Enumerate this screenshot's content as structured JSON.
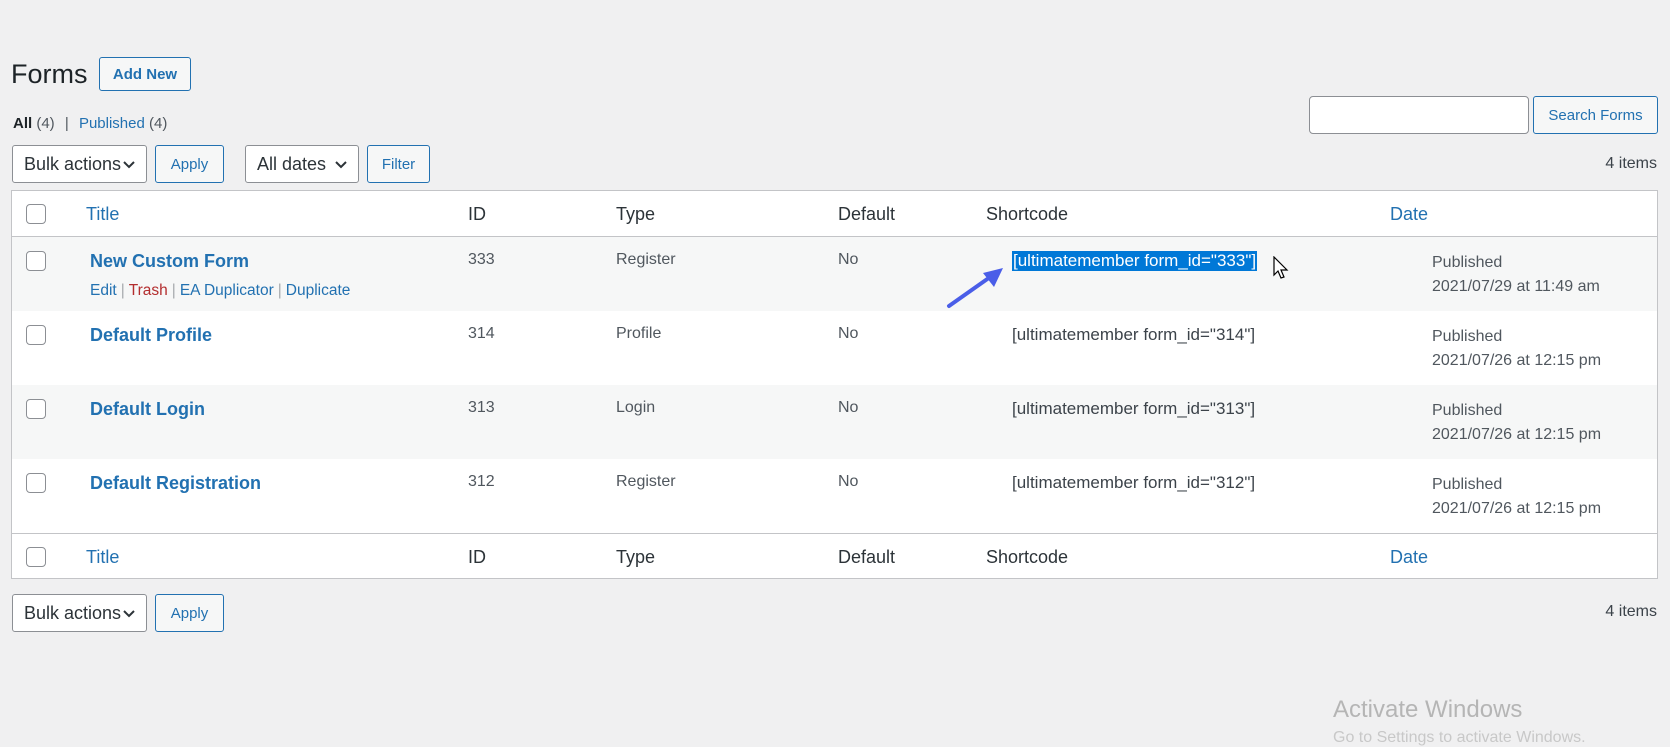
{
  "header": {
    "title": "Forms",
    "add_new_label": "Add New"
  },
  "views": {
    "all_label": "All",
    "all_count": "(4)",
    "published_label": "Published",
    "published_count": "(4)",
    "separator": "|"
  },
  "search": {
    "value": "",
    "button_label": "Search Forms"
  },
  "top_nav": {
    "bulk_actions": "Bulk actions",
    "apply": "Apply",
    "dates": "All dates",
    "filter": "Filter",
    "items": "4 items"
  },
  "bottom_nav": {
    "bulk_actions": "Bulk actions",
    "apply": "Apply",
    "items": "4 items"
  },
  "columns": {
    "title": "Title",
    "id": "ID",
    "type": "Type",
    "default": "Default",
    "shortcode": "Shortcode",
    "date": "Date"
  },
  "row_actions": {
    "edit": "Edit",
    "trash": "Trash",
    "ea_duplicator": "EA Duplicator",
    "duplicate": "Duplicate",
    "sep": "|"
  },
  "rows": [
    {
      "title": "New Custom Form",
      "id": "333",
      "type": "Register",
      "default": "No",
      "shortcode": "[ultimatemember form_id=\"333\"]",
      "status": "Published",
      "date": "2021/07/29 at 11:49 am"
    },
    {
      "title": "Default Profile",
      "id": "314",
      "type": "Profile",
      "default": "No",
      "shortcode": "[ultimatemember form_id=\"314\"]",
      "status": "Published",
      "date": "2021/07/26 at 12:15 pm"
    },
    {
      "title": "Default Login",
      "id": "313",
      "type": "Login",
      "default": "No",
      "shortcode": "[ultimatemember form_id=\"313\"]",
      "status": "Published",
      "date": "2021/07/26 at 12:15 pm"
    },
    {
      "title": "Default Registration",
      "id": "312",
      "type": "Register",
      "default": "No",
      "shortcode": "[ultimatemember form_id=\"312\"]",
      "status": "Published",
      "date": "2021/07/26 at 12:15 pm"
    }
  ],
  "watermark": {
    "title": "Activate Windows",
    "subtitle": "Go to Settings to activate Windows."
  },
  "colors": {
    "link": "#2271b1",
    "trash": "#b32d2e",
    "selection": "#0078d7",
    "arrow": "#4a5ee8"
  }
}
